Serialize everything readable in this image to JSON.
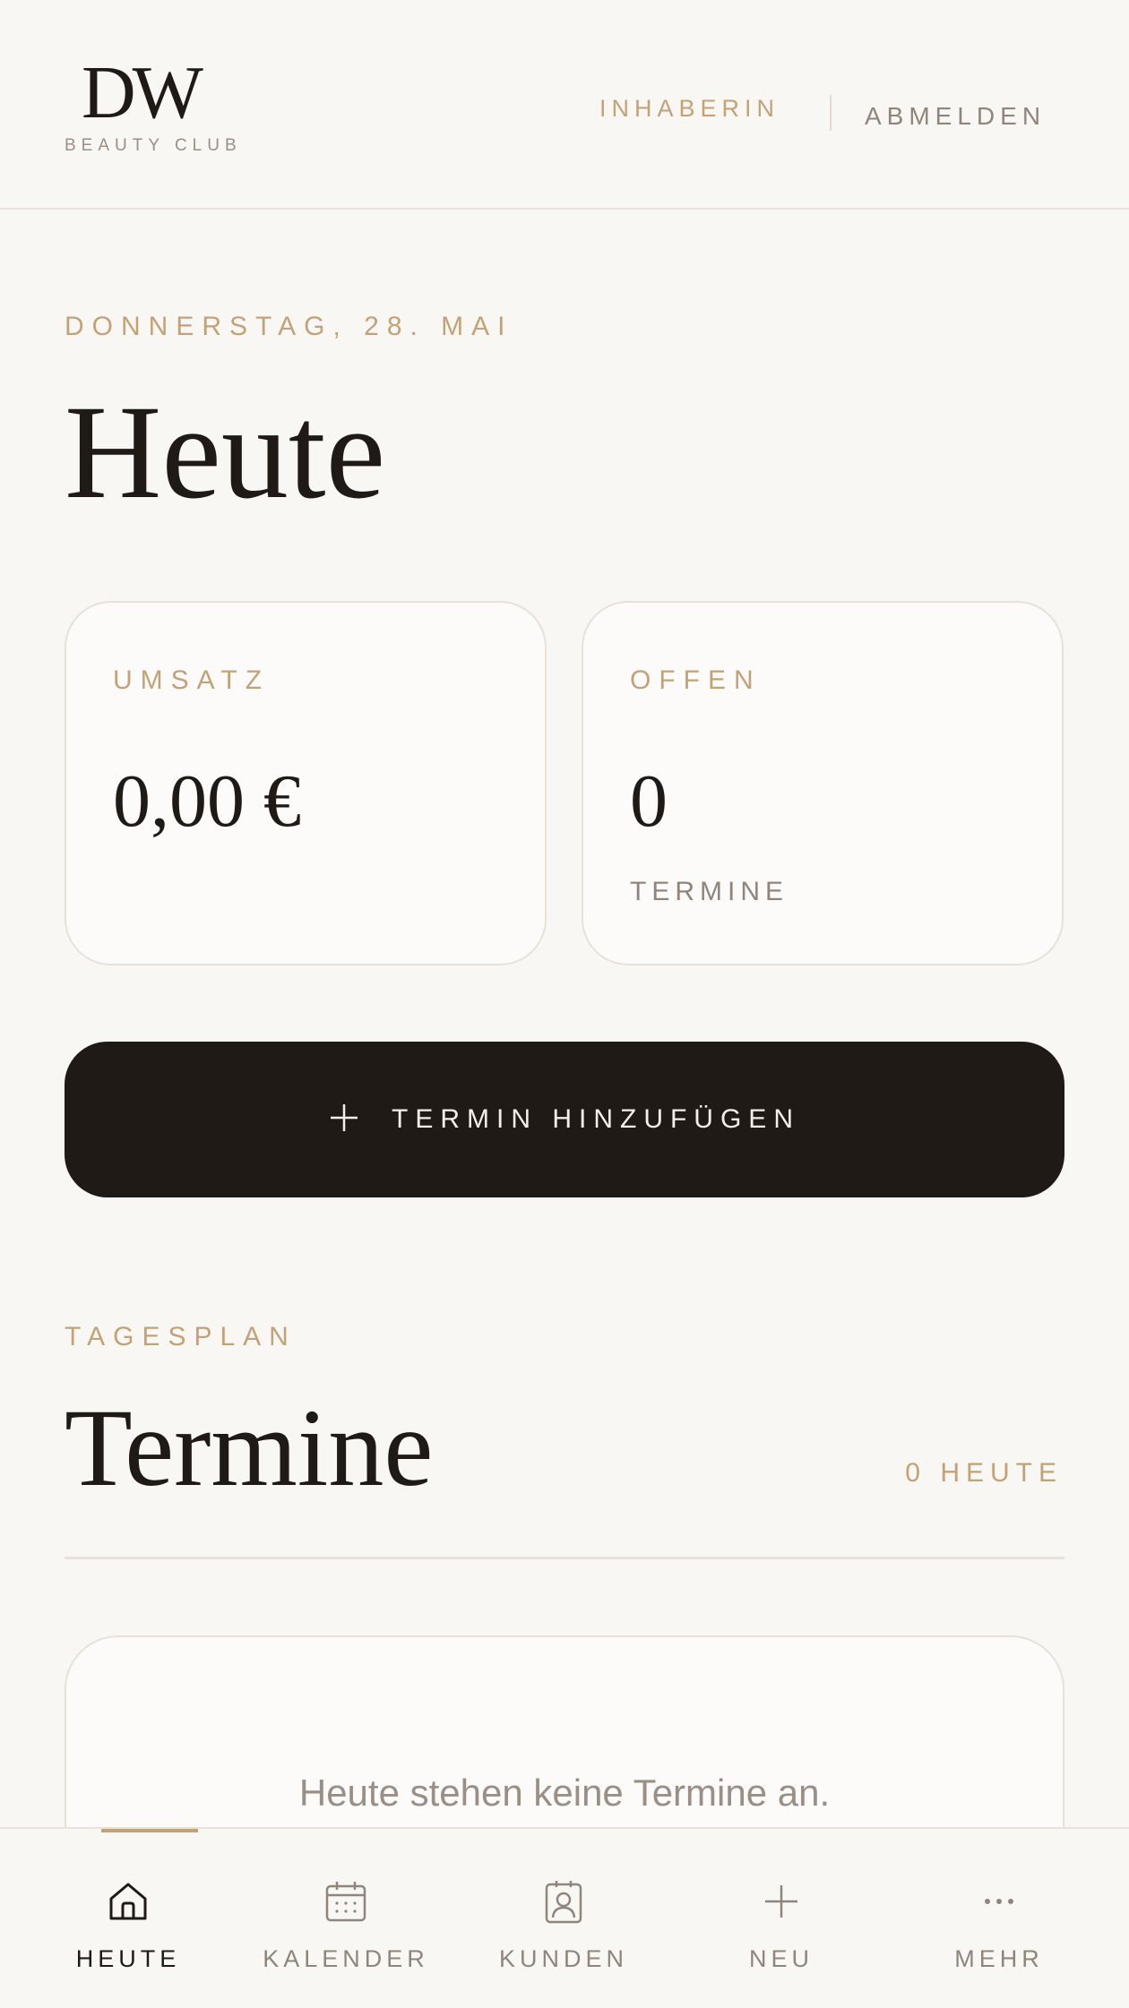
{
  "header": {
    "logo_mark": "DW",
    "logo_sub": "BEAUTY CLUB",
    "role": "INHABERIN",
    "logout": "ABMELDEN"
  },
  "date": "DONNERSTAG, 28. MAI",
  "page_title": "Heute",
  "stats": {
    "revenue": {
      "label": "UMSATZ",
      "value": "0,00 €"
    },
    "open": {
      "label": "OFFEN",
      "value": "0",
      "sub": "TERMINE"
    }
  },
  "cta": {
    "icon": "plus-icon",
    "label": "TERMIN HINZUFÜGEN"
  },
  "schedule": {
    "kicker": "TAGESPLAN",
    "title": "Termine",
    "count": "0 HEUTE",
    "empty": "Heute stehen keine Termine an."
  },
  "nav": [
    {
      "label": "HEUTE",
      "icon": "home-icon",
      "active": true
    },
    {
      "label": "KALENDER",
      "icon": "calendar-icon",
      "active": false
    },
    {
      "label": "KUNDEN",
      "icon": "contacts-icon",
      "active": false
    },
    {
      "label": "NEU",
      "icon": "plus-icon",
      "active": false
    },
    {
      "label": "MEHR",
      "icon": "more-icon",
      "active": false
    }
  ],
  "colors": {
    "background": "#f9f7f4",
    "accent": "#c2a378",
    "primary": "#1f1a16",
    "muted": "#8f857c"
  }
}
